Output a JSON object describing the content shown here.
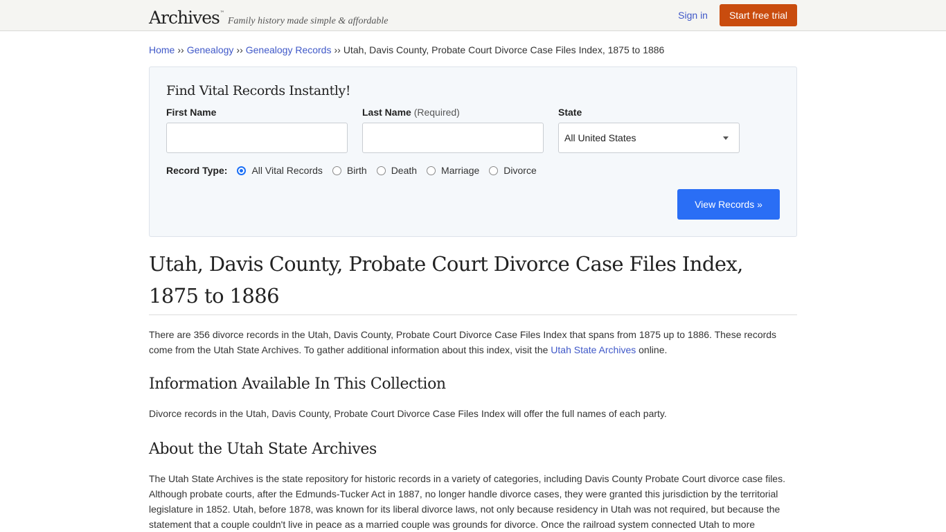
{
  "header": {
    "logo_text": "Archives",
    "logo_tm": "™",
    "tagline": "Family history made simple & affordable",
    "sign_in": "Sign in",
    "start_trial": "Start free trial"
  },
  "breadcrumb": {
    "separator": "››",
    "items": [
      {
        "label": "Home",
        "link": true
      },
      {
        "label": "Genealogy",
        "link": true
      },
      {
        "label": "Genealogy Records",
        "link": true
      },
      {
        "label": "Utah, Davis County, Probate Court Divorce Case Files Index, 1875 to 1886",
        "link": false
      }
    ]
  },
  "search": {
    "title": "Find Vital Records Instantly!",
    "first_name": {
      "label": "First Name",
      "value": "",
      "placeholder": ""
    },
    "last_name": {
      "label": "Last Name",
      "required_note": "(Required)",
      "value": "",
      "placeholder": ""
    },
    "state": {
      "label": "State",
      "selected": "All United States"
    },
    "record_type_label": "Record Type:",
    "record_types": [
      {
        "label": "All Vital Records",
        "checked": true
      },
      {
        "label": "Birth",
        "checked": false
      },
      {
        "label": "Death",
        "checked": false
      },
      {
        "label": "Marriage",
        "checked": false
      },
      {
        "label": "Divorce",
        "checked": false
      }
    ],
    "submit": "View Records »"
  },
  "article": {
    "title": "Utah, Davis County, Probate Court Divorce Case Files Index, 1875 to 1886",
    "intro_before_link": "There are 356 divorce records in the Utah, Davis County, Probate Court Divorce Case Files Index that spans from 1875 up to 1886. These records come from the Utah State Archives. To gather additional information about this index, visit the ",
    "intro_link": "Utah State Archives",
    "intro_after_link": " online.",
    "section1_title": "Information Available In This Collection",
    "section1_text": "Divorce records in the Utah, Davis County, Probate Court Divorce Case Files Index will offer the full names of each party.",
    "section2_title": "About the Utah State Archives",
    "section2_text": "The Utah State Archives is the state repository for historic records in a variety of categories, including Davis County Probate Court divorce case files. Although probate courts, after the Edmunds-Tucker Act in 1887, no longer handle divorce cases, they were granted this jurisdiction by the territorial legislature in 1852. Utah, before 1878, was known for its liberal divorce laws, not only because residency in Utah was not required, but because the statement that a couple couldn't live in peace as a married couple was grounds for divorce. Once the railroad system connected Utah to more"
  },
  "colors": {
    "link": "#3f58c8",
    "trial_button": "#c94c0e",
    "primary_button": "#2a6ef5",
    "search_panel_bg": "#f5f8fb",
    "header_bg": "#f5f5f2"
  }
}
